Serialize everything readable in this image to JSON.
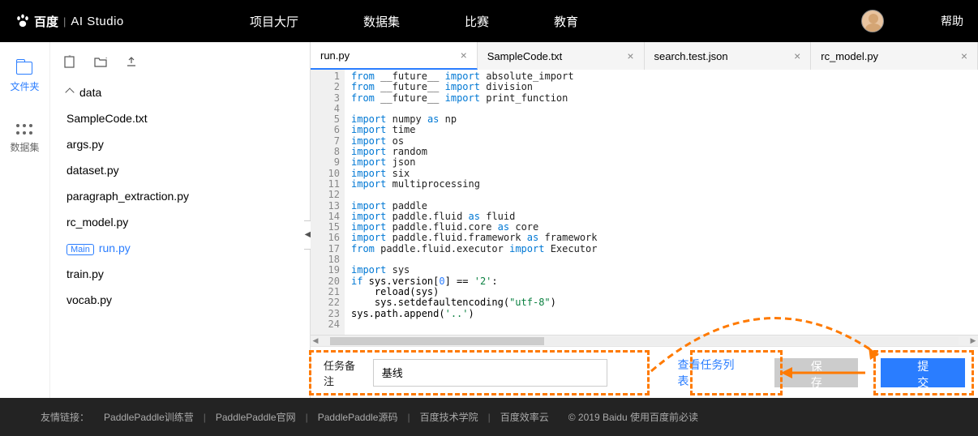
{
  "header": {
    "brand_cn": "百度",
    "brand_en": "AI Studio",
    "nav": [
      "项目大厅",
      "数据集",
      "比赛",
      "教育"
    ],
    "help": "帮助"
  },
  "leftrail": {
    "files": "文件夹",
    "dataset": "数据集"
  },
  "tree": {
    "folder": "data",
    "items": [
      "SampleCode.txt",
      "args.py",
      "dataset.py",
      "paragraph_extraction.py",
      "rc_model.py",
      "run.py",
      "train.py",
      "vocab.py"
    ],
    "main_badge": "Main",
    "active": "run.py"
  },
  "tabs": [
    {
      "label": "run.py",
      "active": true
    },
    {
      "label": "SampleCode.txt",
      "active": false
    },
    {
      "label": "search.test.json",
      "active": false
    },
    {
      "label": "rc_model.py",
      "active": false
    }
  ],
  "code": {
    "lines": [
      {
        "n": 1,
        "t": "from",
        "a": "__future__",
        "k": "import",
        "b": "absolute_import"
      },
      {
        "n": 2,
        "t": "from",
        "a": "__future__",
        "k": "import",
        "b": "division"
      },
      {
        "n": 3,
        "t": "from",
        "a": "__future__",
        "k": "import",
        "b": "print_function"
      },
      {
        "n": 4,
        "blank": true
      },
      {
        "n": 5,
        "t": "import",
        "a": "numpy",
        "k": "as",
        "b": "np"
      },
      {
        "n": 6,
        "t": "import",
        "a": "time"
      },
      {
        "n": 7,
        "t": "import",
        "a": "os"
      },
      {
        "n": 8,
        "t": "import",
        "a": "random"
      },
      {
        "n": 9,
        "t": "import",
        "a": "json"
      },
      {
        "n": 10,
        "t": "import",
        "a": "six"
      },
      {
        "n": 11,
        "t": "import",
        "a": "multiprocessing"
      },
      {
        "n": 12,
        "blank": true
      },
      {
        "n": 13,
        "t": "import",
        "a": "paddle"
      },
      {
        "n": 14,
        "t": "import",
        "a": "paddle.fluid",
        "k": "as",
        "b": "fluid"
      },
      {
        "n": 15,
        "t": "import",
        "a": "paddle.fluid.core",
        "k": "as",
        "b": "core"
      },
      {
        "n": 16,
        "t": "import",
        "a": "paddle.fluid.framework",
        "k": "as",
        "b": "framework"
      },
      {
        "n": 17,
        "t": "from",
        "a": "paddle.fluid.executor",
        "k": "import",
        "b": "Executor"
      },
      {
        "n": 18,
        "blank": true
      },
      {
        "n": 19,
        "t": "import",
        "a": "sys"
      },
      {
        "n": 20,
        "raw": "if sys.version[0] == '2':",
        "if": true
      },
      {
        "n": 21,
        "raw": "    reload(sys)"
      },
      {
        "n": 22,
        "raw": "    sys.setdefaultencoding(\"utf-8\")",
        "str": true
      },
      {
        "n": 23,
        "raw": "sys.path.append('..')",
        "str2": true
      },
      {
        "n": 24,
        "blank": true
      }
    ]
  },
  "bottom": {
    "task_label": "任务备注",
    "task_value": "基线",
    "view_list": "查看任务列表",
    "save": "保存",
    "submit": "提交"
  },
  "footer": {
    "prefix": "友情链接：",
    "links": [
      "PaddlePaddle训练营",
      "PaddlePaddle官网",
      "PaddlePaddle源码",
      "百度技术学院",
      "百度效率云"
    ],
    "copyright": "© 2019 Baidu 使用百度前必读"
  }
}
